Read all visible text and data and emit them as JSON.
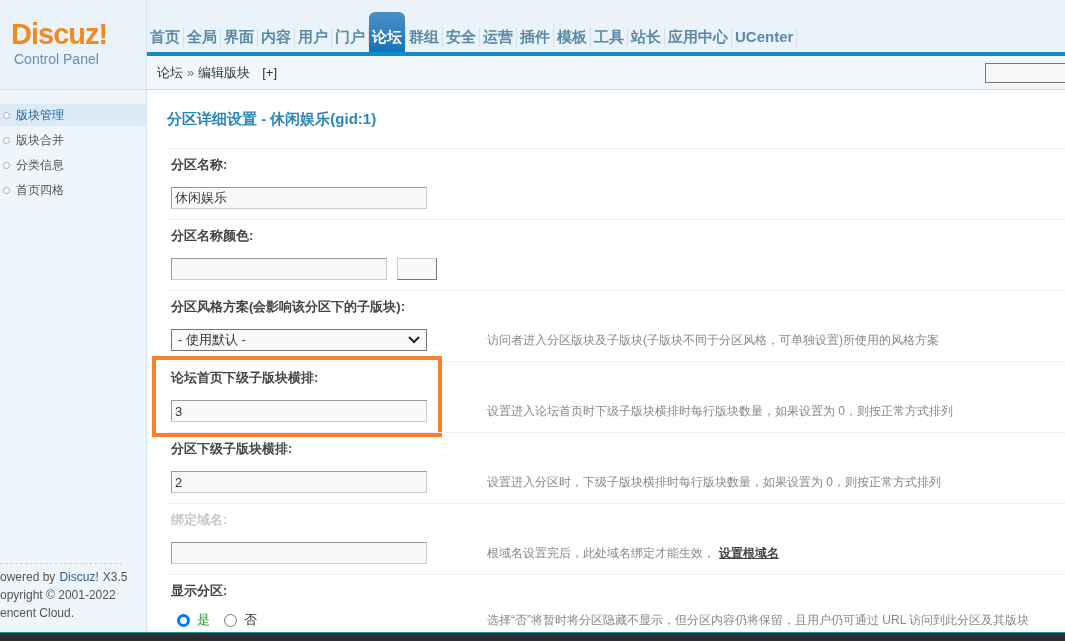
{
  "logo": {
    "title": "Discuz!",
    "subtitle": "Control Panel"
  },
  "nav_tabs": [
    {
      "label": "首页",
      "selected": false
    },
    {
      "label": "全局",
      "selected": false
    },
    {
      "label": "界面",
      "selected": false
    },
    {
      "label": "内容",
      "selected": false
    },
    {
      "label": "用户",
      "selected": false
    },
    {
      "label": "门户",
      "selected": false
    },
    {
      "label": "论坛",
      "selected": true
    },
    {
      "label": "群组",
      "selected": false
    },
    {
      "label": "安全",
      "selected": false
    },
    {
      "label": "运营",
      "selected": false
    },
    {
      "label": "插件",
      "selected": false
    },
    {
      "label": "模板",
      "selected": false
    },
    {
      "label": "工具",
      "selected": false
    },
    {
      "label": "站长",
      "selected": false
    },
    {
      "label": "应用中心",
      "selected": false
    },
    {
      "label": "UCenter",
      "selected": false
    }
  ],
  "breadcrumb": {
    "items": [
      "论坛",
      "编辑版块"
    ],
    "separator": "»",
    "add": "[+]"
  },
  "sidebar": {
    "items": [
      {
        "label": "版块管理",
        "selected": true
      },
      {
        "label": "版块合并",
        "selected": false
      },
      {
        "label": "分类信息",
        "selected": false
      },
      {
        "label": "首页四格",
        "selected": false
      }
    ],
    "powered_by": {
      "text": "owered by",
      "link": "Discuz!",
      "version": "X3.5"
    },
    "copyright": "opyright © 2001-2022",
    "company": "encent Cloud."
  },
  "page_title": "分区详细设置 - 休闲娱乐(gid:1)",
  "fields": [
    {
      "kind": "text",
      "label": "分区名称:",
      "value": "休闲娱乐",
      "disabled": false,
      "highlighted": false
    },
    {
      "kind": "color",
      "label": "分区名称颜色:",
      "disabled": false,
      "highlighted": false
    },
    {
      "kind": "select",
      "label": "分区风格方案(会影响该分区下的子版块):",
      "value": "- 使用默认 -",
      "hint": "访问者进入分区版块及子版块(子版块不同于分区风格，可单独设置)所使用的风格方案",
      "disabled": false,
      "highlighted": false
    },
    {
      "kind": "text",
      "label": "论坛首页下级子版块横排:",
      "value": "3",
      "hint": "设置进入论坛首页时下级子版块横排时每行版块数量，如果设置为 0，则按正常方式排列",
      "disabled": false,
      "highlighted": true
    },
    {
      "kind": "text",
      "label": "分区下级子版块横排:",
      "value": "2",
      "hint": "设置进入分区时，下级子版块横排时每行版块数量，如果设置为 0，则按正常方式排列",
      "disabled": false,
      "highlighted": false
    },
    {
      "kind": "text",
      "label": "绑定域名:",
      "hint": "根域名设置完后，此处域名绑定才能生效，",
      "hint_link": "设置根域名",
      "disabled": true,
      "highlighted": false
    },
    {
      "kind": "radio",
      "label": "显示分区:",
      "options": [
        {
          "label": "是",
          "selected": true
        },
        {
          "label": "否",
          "selected": false
        }
      ],
      "hint": "选择“否”将暂时将分区隐藏不显示，但分区内容仍将保留，且用户仍可通过 URL 访问到此分区及其版块",
      "disabled": false,
      "highlighted": false
    }
  ]
}
